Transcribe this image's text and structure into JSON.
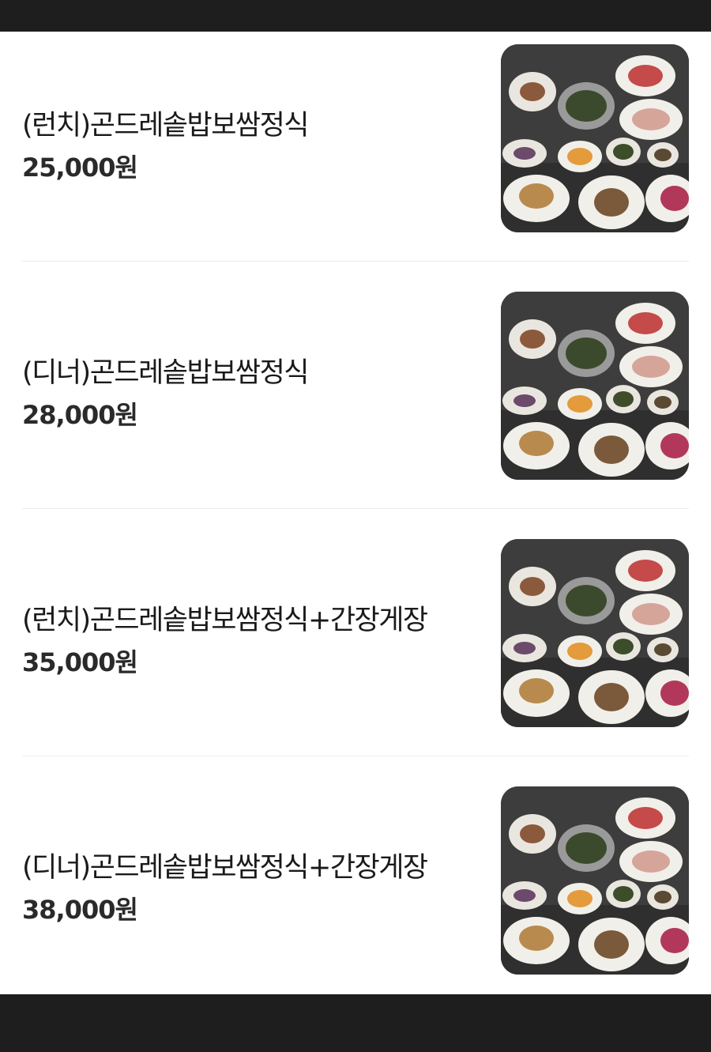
{
  "menu": {
    "items": [
      {
        "name": "(런치)곤드레솥밥보쌈정식",
        "price": "25,000원"
      },
      {
        "name": "(디너)곤드레솥밥보쌈정식",
        "price": "28,000원"
      },
      {
        "name": "(런치)곤드레솥밥보쌈정식+간장게장",
        "price": "35,000원"
      },
      {
        "name": "(디너)곤드레솥밥보쌈정식+간장게장",
        "price": "38,000원"
      }
    ]
  },
  "colors": {
    "background": "#ffffff",
    "system_bar": "#1e1e1e",
    "text": "#1a1a1a",
    "divider": "#ececec"
  }
}
